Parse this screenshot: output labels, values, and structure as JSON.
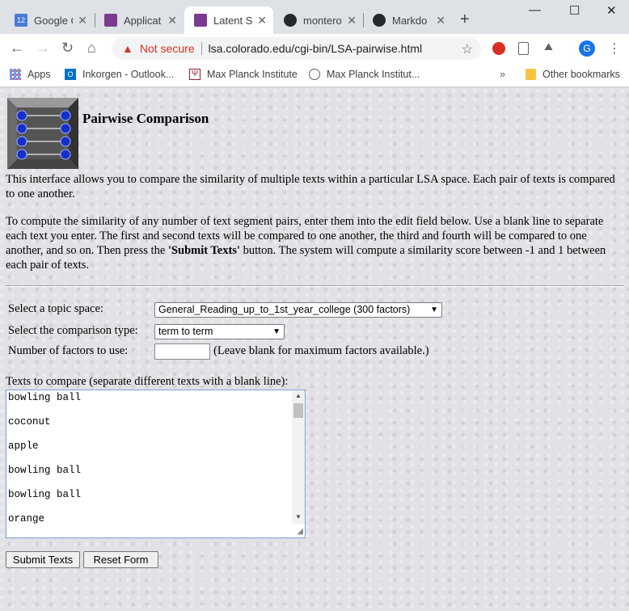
{
  "browser": {
    "tabs": [
      {
        "title": "Google C",
        "favicon_color": "#4a7bd6",
        "favicon_text": "12",
        "active": false
      },
      {
        "title": "Applicat",
        "favicon_color": "#7a3b8f",
        "favicon_text": "",
        "active": false
      },
      {
        "title": "Latent Se",
        "favicon_color": "#7a3b8f",
        "favicon_text": "",
        "active": true
      },
      {
        "title": "montero",
        "favicon_color": "#24292e",
        "favicon_text": "",
        "active": false
      },
      {
        "title": "Markdo",
        "favicon_color": "#24292e",
        "favicon_text": "",
        "active": false
      }
    ],
    "security_label": "Not secure",
    "url": "lsa.colorado.edu/cgi-bin/LSA-pairwise.html",
    "profile_initial": "G",
    "bookmarks": [
      {
        "label": "Apps",
        "icon": "apps-grid-icon"
      },
      {
        "label": "Inkorgen - Outlook...",
        "icon": "outlook-icon"
      },
      {
        "label": "Max Planck Institute",
        "icon": "mpi-icon"
      },
      {
        "label": "Max Planck Institut...",
        "icon": "globe-icon"
      }
    ],
    "other_bookmarks": "Other bookmarks"
  },
  "page": {
    "title": "Pairwise Comparison",
    "intro": "This interface allows you to compare the similarity of multiple texts within a particular LSA space. Each pair of texts is compared to one another.",
    "instructions_pre": "To compute the similarity of any number of text segment pairs, enter them into the edit field below. Use a blank line to separate each text you enter. The first and second texts will be compared to one another, the third and fourth will be compared to one another, and so on. Then press the ",
    "instructions_bold": "'Submit Texts'",
    "instructions_post": " button. The system will compute a similarity score between -1 and 1 between each pair of texts.",
    "form": {
      "topic_label": "Select a topic space:",
      "topic_value": "General_Reading_up_to_1st_year_college (300 factors)",
      "comparison_label": "Select the comparison type:",
      "comparison_value": "term to term",
      "factors_label": "Number of factors to use:",
      "factors_value": "",
      "factors_hint": "(Leave blank for maximum factors available.)",
      "texts_label": "Texts to compare (separate different texts with a blank line):",
      "texts": [
        "bowling ball",
        "coconut",
        "apple",
        "bowling ball",
        "bowling ball",
        "orange"
      ],
      "submit_label": "Submit Texts",
      "reset_label": "Reset Form"
    }
  }
}
